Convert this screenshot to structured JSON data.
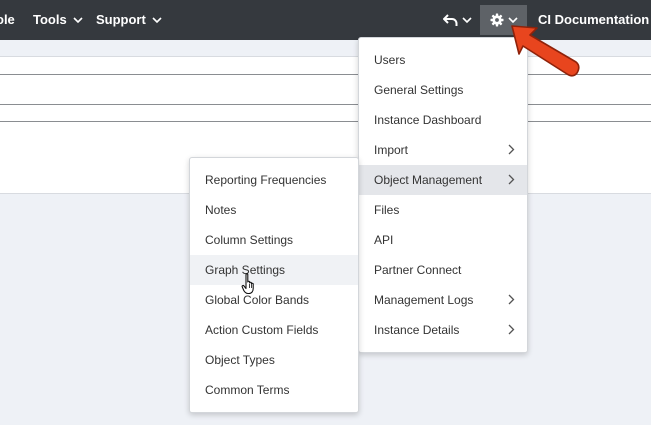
{
  "topbar": {
    "nav": [
      {
        "label": "ole"
      },
      {
        "label": "Tools"
      },
      {
        "label": "Support"
      }
    ],
    "account": {
      "label": "CI Documentation"
    }
  },
  "settings_menu": {
    "items": [
      {
        "label": "Users",
        "has_submenu": false
      },
      {
        "label": "General Settings",
        "has_submenu": false
      },
      {
        "label": "Instance Dashboard",
        "has_submenu": false
      },
      {
        "label": "Import",
        "has_submenu": true
      },
      {
        "label": "Object Management",
        "has_submenu": true,
        "active": true
      },
      {
        "label": "Files",
        "has_submenu": false
      },
      {
        "label": "API",
        "has_submenu": false
      },
      {
        "label": "Partner Connect",
        "has_submenu": false
      },
      {
        "label": "Management Logs",
        "has_submenu": true
      },
      {
        "label": "Instance Details",
        "has_submenu": true
      }
    ]
  },
  "object_management_submenu": {
    "items": [
      {
        "label": "Reporting Frequencies"
      },
      {
        "label": "Notes"
      },
      {
        "label": "Column Settings"
      },
      {
        "label": "Graph Settings",
        "hover": true
      },
      {
        "label": "Global Color Bands"
      },
      {
        "label": "Action Custom Fields"
      },
      {
        "label": "Object Types"
      },
      {
        "label": "Common Terms"
      }
    ]
  },
  "colors": {
    "topbar": "#35393e",
    "gear_button_active": "#5e6267",
    "annotation_arrow": "#e8451e",
    "active_item": "#e4e6ea",
    "page_background": "#eef1f6"
  },
  "icons": {
    "back": "undo-arrow-icon",
    "settings": "gear-icon",
    "dropdown": "chevron-down-icon",
    "submenu": "chevron-right-icon",
    "pointer": "hand-cursor-icon"
  }
}
